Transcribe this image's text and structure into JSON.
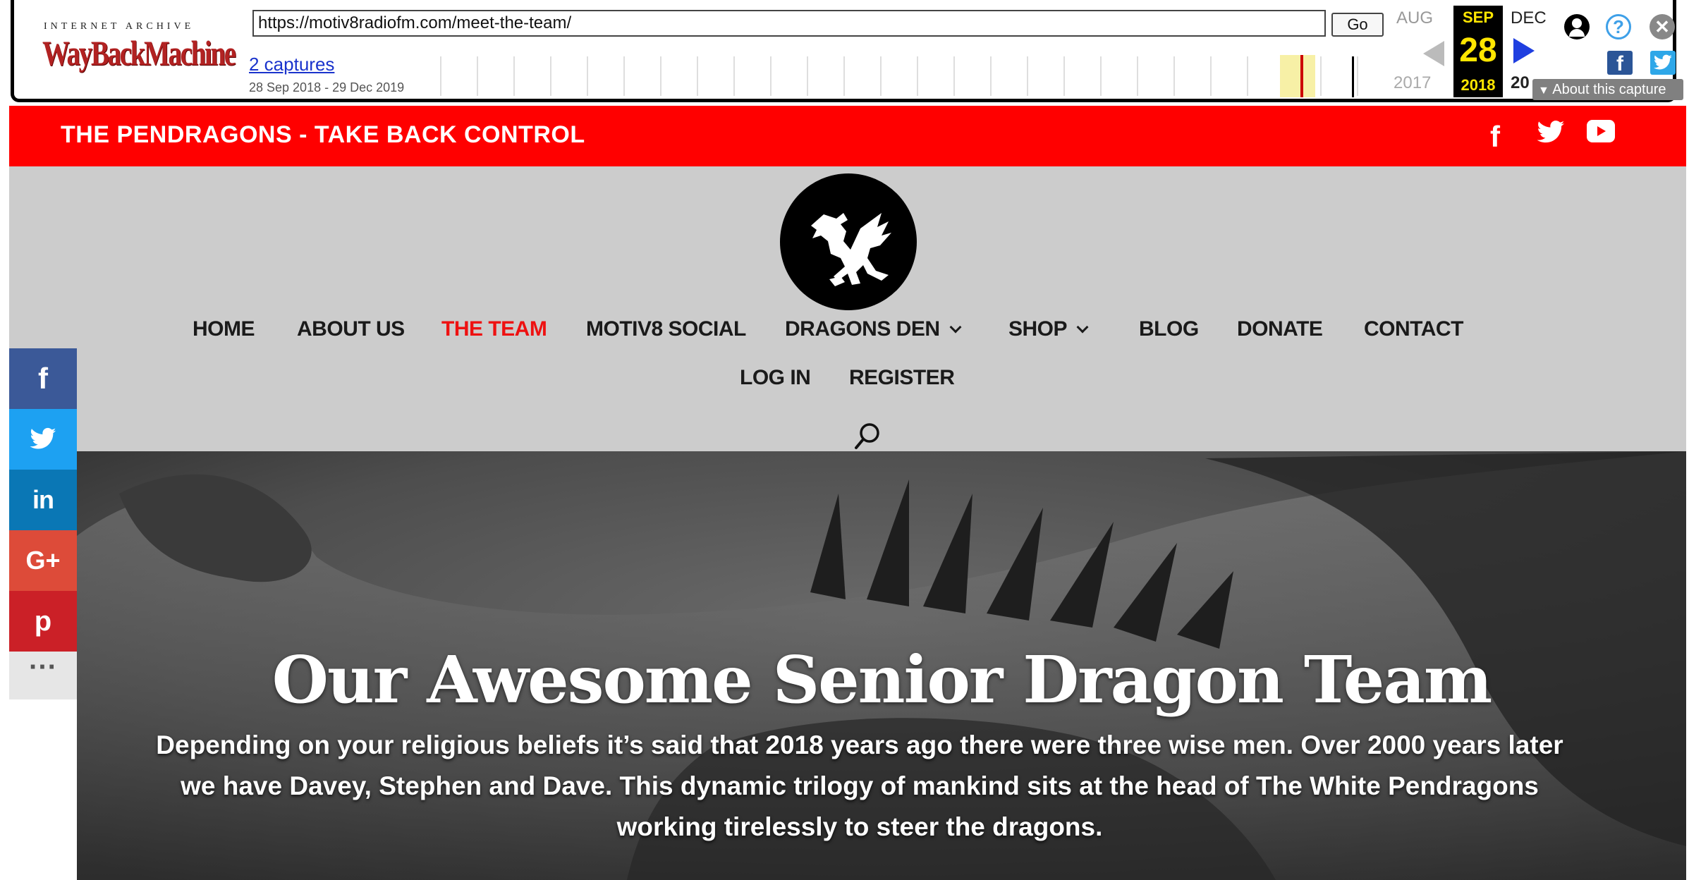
{
  "wayback": {
    "logo_top": "INTERNET ARCHIVE",
    "logo_main": "WayBackMachine",
    "url": "https://motiv8radiofm.com/meet-the-team/",
    "go_label": "Go",
    "captures_link": "2 captures",
    "capture_range": "28 Sep 2018 - 29 Dec 2019",
    "prev_month": "AUG",
    "current_month": "SEP",
    "next_month": "DEC",
    "current_day": "28",
    "prev_year": "2017",
    "current_year": "2018",
    "next_year": "20",
    "about_label": "About this capture",
    "help_glyph": "?",
    "close_glyph": "✕",
    "facebook_glyph": "f"
  },
  "site": {
    "topbar_title": "THE PENDRAGONS - TAKE BACK CONTROL",
    "topbar_facebook": "f",
    "colors": {
      "topbar": "#ff0000",
      "header": "#cccccc",
      "active_nav": "#ee1111"
    }
  },
  "nav": {
    "row1": [
      "HOME",
      "ABOUT US",
      "THE TEAM",
      "MOTIV8 SOCIAL",
      "DRAGONS DEN",
      "SHOP",
      "BLOG",
      "DONATE",
      "CONTACT"
    ],
    "row2": [
      "LOG IN",
      "REGISTER"
    ],
    "active": "THE TEAM"
  },
  "share": {
    "facebook": "f",
    "linkedin": "in",
    "google_plus": "G+",
    "pinterest": "p",
    "more": "···"
  },
  "hero": {
    "title": "Our Awesome Senior Dragon Team",
    "text": "Depending on your religious beliefs it’s said that 2018 years ago there were three wise men. Over 2000 years later we have Davey, Stephen and Dave. This dynamic trilogy of mankind sits at the head of The White Pendragons working tirelessly to steer the dragons."
  }
}
